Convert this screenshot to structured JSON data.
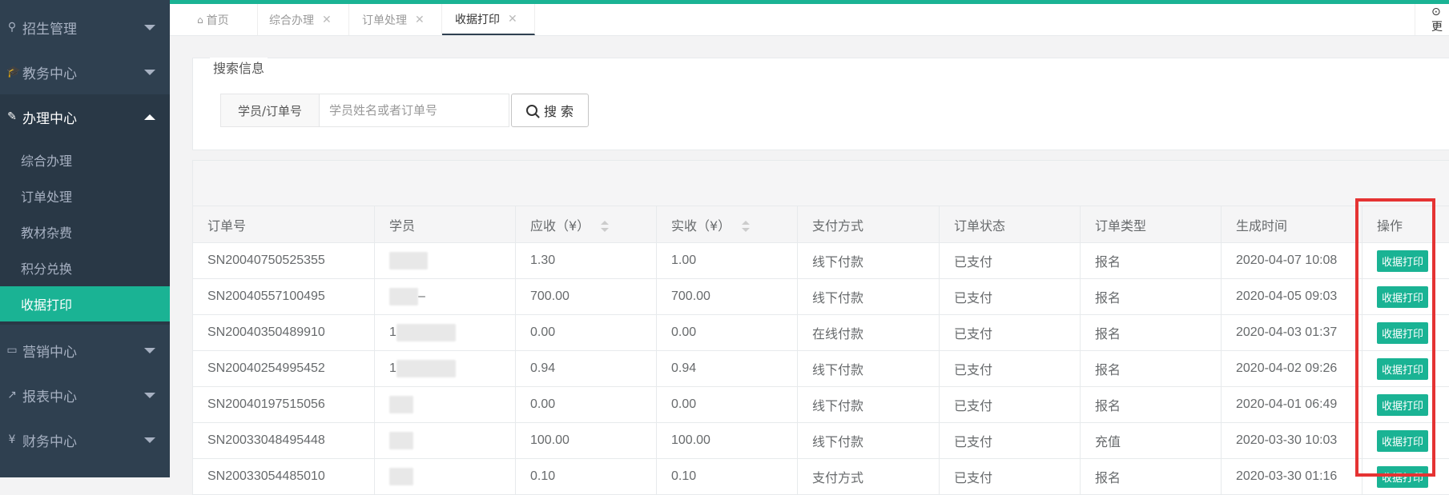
{
  "sidebar": {
    "items": [
      {
        "icon": "user-icon",
        "glyph": "⚲",
        "label": "招生管理"
      },
      {
        "icon": "graduation-cap-icon",
        "glyph": "🎓",
        "label": "教务中心"
      },
      {
        "icon": "edit-icon",
        "glyph": "✎",
        "label": "办理中心"
      },
      {
        "icon": "laptop-icon",
        "glyph": "▭",
        "label": "营销中心"
      },
      {
        "icon": "line-chart-icon",
        "glyph": "↗",
        "label": "报表中心"
      },
      {
        "icon": "yen-icon",
        "glyph": "¥",
        "label": "财务中心"
      }
    ],
    "subitems": [
      "综合办理",
      "订单处理",
      "教材杂费",
      "积分兑换",
      "收据打印"
    ]
  },
  "tabs": [
    {
      "label": "首页"
    },
    {
      "label": "综合办理"
    },
    {
      "label": "订单处理"
    },
    {
      "label": "收据打印"
    }
  ],
  "tab_right_label": "⊙ 更",
  "search": {
    "legend": "搜索信息",
    "addon": "学员/订单号",
    "placeholder": "学员姓名或者订单号",
    "button": "搜 索"
  },
  "table": {
    "headers": [
      "订单号",
      "学员",
      "应收（¥）",
      "实收（¥）",
      "支付方式",
      "订单状态",
      "订单类型",
      "生成时间",
      "操作"
    ],
    "rows": [
      {
        "order": "SN20040750525355",
        "student": "",
        "due": "1.30",
        "paid": "1.00",
        "method": "线下付款",
        "status": "已支付",
        "type": "报名",
        "time": "2020-04-07 10:08",
        "action": "收据打印"
      },
      {
        "order": "SN20040557100495",
        "student": "–",
        "due": "700.00",
        "paid": "700.00",
        "method": "线下付款",
        "status": "已支付",
        "type": "报名",
        "time": "2020-04-05 09:03",
        "action": "收据打印"
      },
      {
        "order": "SN20040350489910",
        "student": "1",
        "due": "0.00",
        "paid": "0.00",
        "method": "在线付款",
        "status": "已支付",
        "type": "报名",
        "time": "2020-04-03 01:37",
        "action": "收据打印"
      },
      {
        "order": "SN20040254995452",
        "student": "1",
        "due": "0.94",
        "paid": "0.94",
        "method": "线下付款",
        "status": "已支付",
        "type": "报名",
        "time": "2020-04-02 09:26",
        "action": "收据打印"
      },
      {
        "order": "SN20040197515056",
        "student": "",
        "due": "0.00",
        "paid": "0.00",
        "method": "线下付款",
        "status": "已支付",
        "type": "报名",
        "time": "2020-04-01 06:49",
        "action": "收据打印"
      },
      {
        "order": "SN20033048495448",
        "student": "",
        "due": "100.00",
        "paid": "100.00",
        "method": "线下付款",
        "status": "已支付",
        "type": "充值",
        "time": "2020-03-30 10:03",
        "action": "收据打印"
      },
      {
        "order": "SN20033054485010",
        "student": "",
        "due": "0.10",
        "paid": "0.10",
        "method": "支付方式",
        "status": "已支付",
        "type": "报名",
        "time": "2020-03-30 01:16",
        "action": "收据打印"
      }
    ]
  },
  "colors": {
    "accent": "#1ab394",
    "sidebar": "#2f4050",
    "highlight": "#e53333"
  }
}
